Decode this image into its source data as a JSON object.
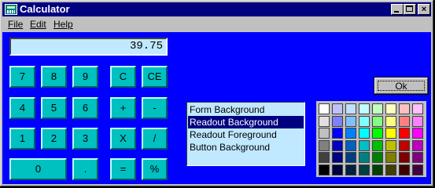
{
  "window": {
    "title": "Calculator"
  },
  "menu": {
    "file": "File",
    "edit": "Edit",
    "help": "Help"
  },
  "readout": {
    "value": "39.75"
  },
  "keys": {
    "k7": "7",
    "k8": "8",
    "k9": "9",
    "clear": "C",
    "clear_entry": "CE",
    "k4": "4",
    "k5": "5",
    "k6": "6",
    "plus": "+",
    "minus": "-",
    "k1": "1",
    "k2": "2",
    "k3": "3",
    "multiply": "X",
    "divide": "/",
    "k0": "0",
    "decimal": ".",
    "equals": "=",
    "percent": "%"
  },
  "ok_button": "Ok",
  "color_targets": {
    "items": [
      "Form Background",
      "Readout Background",
      "Readout Foreground",
      "Button Background"
    ],
    "selected": "Readout Background"
  },
  "palette_colors": [
    [
      "#ffffff",
      "#c0c0ff",
      "#c0e0ff",
      "#c0ffff",
      "#c0ffc0",
      "#ffffc0",
      "#ffc0c0",
      "#ffc0ff"
    ],
    [
      "#e0e0e0",
      "#8080ff",
      "#80c0ff",
      "#80ffff",
      "#80ff80",
      "#ffff80",
      "#ff8080",
      "#ff80ff"
    ],
    [
      "#c0c0c0",
      "#0000ff",
      "#0080ff",
      "#00ffff",
      "#00ff00",
      "#ffff00",
      "#ff0000",
      "#ff00ff"
    ],
    [
      "#808080",
      "#0000c0",
      "#0060c0",
      "#00c0c0",
      "#00c000",
      "#c0c000",
      "#c00000",
      "#c000c0"
    ],
    [
      "#404040",
      "#000080",
      "#004080",
      "#008080",
      "#008000",
      "#808000",
      "#800000",
      "#800080"
    ],
    [
      "#000000",
      "#000040",
      "#002040",
      "#004040",
      "#004000",
      "#404000",
      "#400000",
      "#400040"
    ]
  ]
}
